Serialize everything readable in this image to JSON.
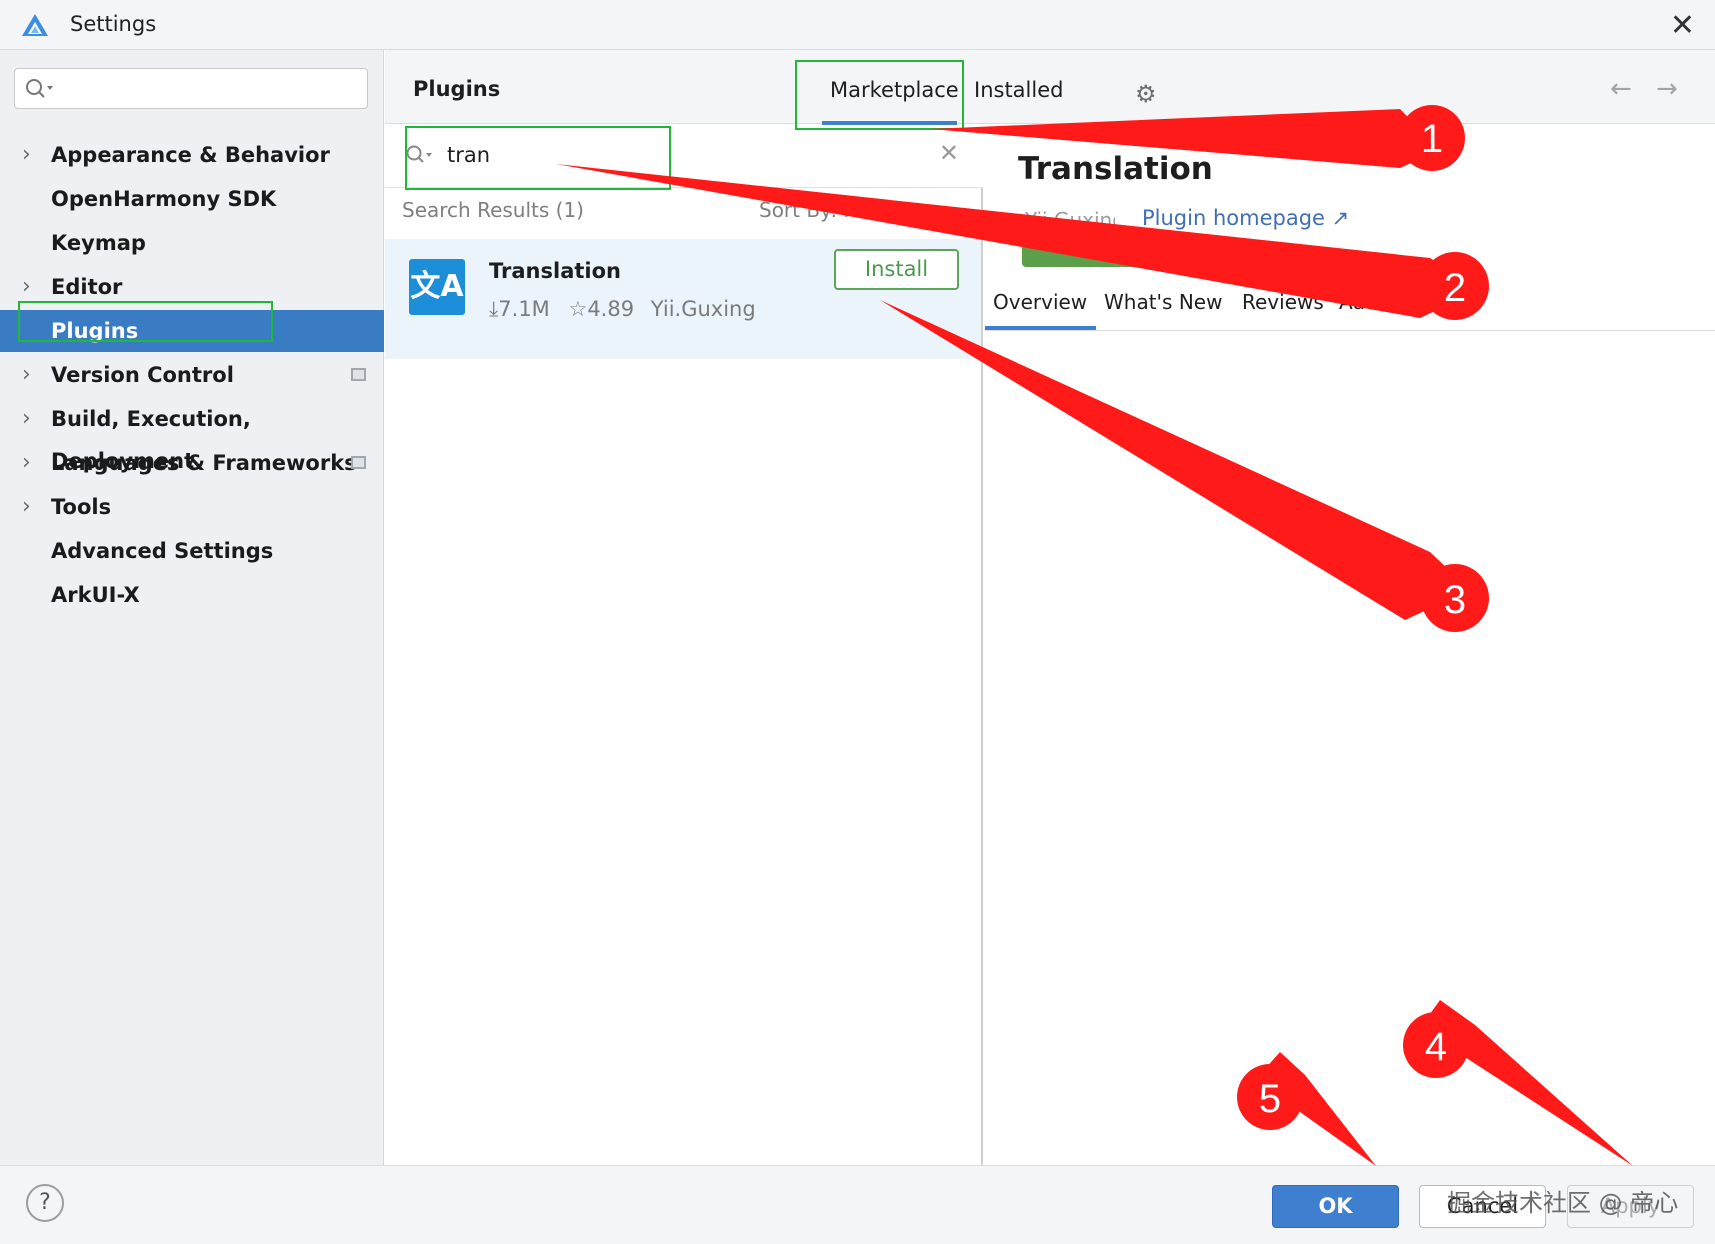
{
  "window": {
    "title": "Settings",
    "close_glyph": "✕"
  },
  "sidebar": {
    "search_placeholder": "",
    "items": [
      {
        "label": "Appearance & Behavior",
        "chevron": "›",
        "badge": false
      },
      {
        "label": "OpenHarmony SDK",
        "chevron": "",
        "badge": false
      },
      {
        "label": "Keymap",
        "chevron": "",
        "badge": false
      },
      {
        "label": "Editor",
        "chevron": "›",
        "badge": false
      },
      {
        "label": "Plugins",
        "chevron": "",
        "badge": false,
        "selected": true
      },
      {
        "label": "Version Control",
        "chevron": "›",
        "badge": true
      },
      {
        "label": "Build, Execution, Deployment",
        "chevron": "›",
        "badge": false
      },
      {
        "label": "Languages & Frameworks",
        "chevron": "›",
        "badge": true
      },
      {
        "label": "Tools",
        "chevron": "›",
        "badge": false
      },
      {
        "label": "Advanced Settings",
        "chevron": "",
        "badge": false
      },
      {
        "label": "ArkUI-X",
        "chevron": "",
        "badge": false
      }
    ]
  },
  "header": {
    "title": "Plugins",
    "tabs": [
      {
        "label": "Marketplace",
        "active": true
      },
      {
        "label": "Installed",
        "active": false
      }
    ],
    "gear_glyph": "⚙",
    "back_glyph": "←",
    "forward_glyph": "→"
  },
  "plugin_search": {
    "value": "tran",
    "clear_glyph": "✕"
  },
  "results": {
    "heading": "Search Results (1)",
    "sort_label": "Sort By: Re",
    "items": [
      {
        "name": "Translation",
        "icon_text": "文A",
        "downloads": "⤓7.1M",
        "rating": "☆4.89",
        "vendor": "Yii.Guxing",
        "action": "Install"
      }
    ]
  },
  "detail": {
    "title": "Translation",
    "vendor": "Yii.Guxing",
    "homepage": "Plugin homepage ↗",
    "tabs": [
      "Overview",
      "What's New",
      "Reviews",
      "Additional Info"
    ]
  },
  "footer": {
    "help": "?",
    "ok": "OK",
    "cancel": "Cancel",
    "apply": "Apply",
    "watermark": "掘金技术社区 @ 帝心"
  },
  "annotations": {
    "markers": [
      "1",
      "2",
      "3",
      "4",
      "5"
    ],
    "color": "#ff1a1a",
    "highlight_color": "#1fb839"
  },
  "colors": {
    "selection": "#3a7cc4",
    "accent": "#3f7fd0",
    "install_green": "#4b9a4b"
  }
}
